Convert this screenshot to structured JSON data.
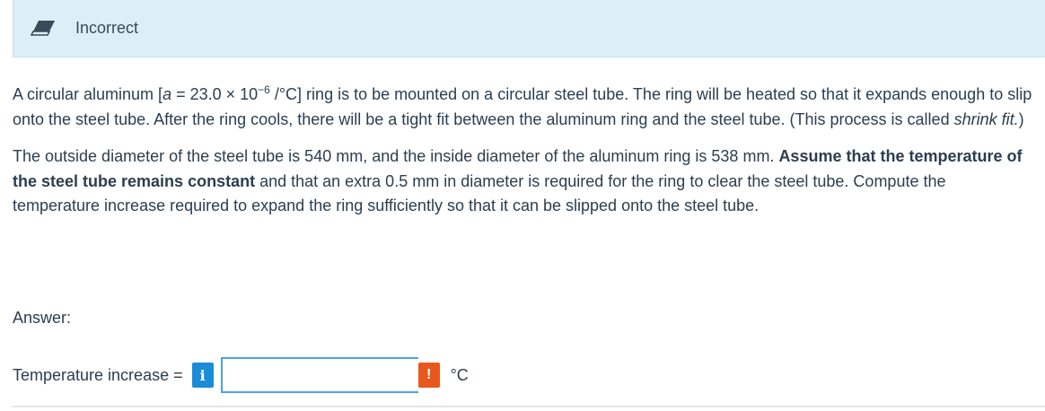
{
  "status": {
    "label": "Incorrect",
    "icon": "eraser-icon"
  },
  "question": {
    "p1_a": "A circular aluminum [",
    "p1_alpha": "a",
    "p1_b": " = 23.0 × 10",
    "p1_exp": "−6",
    "p1_c": " /°C] ring is to be mounted on a circular steel tube.  The ring will be heated so that it expands enough to slip onto the steel tube.  After the ring cools, there will be a tight fit between the aluminum ring and the steel tube. (This process is called ",
    "p1_em": "shrink fit.",
    "p1_d": ")",
    "p2_a": "The outside diameter of the steel tube is 540 mm, and the inside diameter of the aluminum ring is 538 mm. ",
    "p2_strong": "Assume that the temperature of the steel tube remains constant",
    "p2_b": " and that an extra 0.5 mm in diameter is required for the ring to clear the steel tube. Compute the temperature increase required to expand the ring sufficiently so that it can be slipped onto the steel tube."
  },
  "answer": {
    "label": "Answer:",
    "row_label": "Temperature increase =",
    "info_glyph": "i",
    "input_value": "",
    "error_glyph": "!",
    "unit": "°C"
  },
  "colors": {
    "banner_bg": "#ddeef8",
    "info_badge": "#1a8cd8",
    "error_badge": "#e8571e",
    "input_border": "#4aa3df"
  }
}
